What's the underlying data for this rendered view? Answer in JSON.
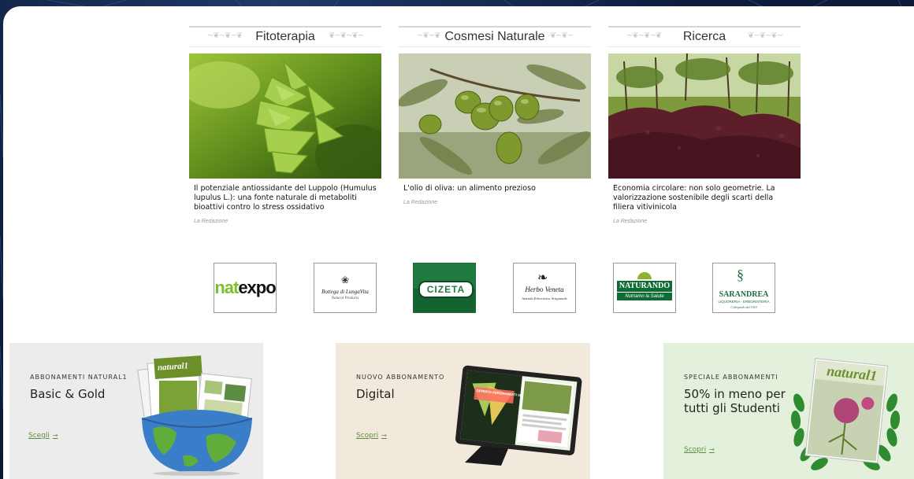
{
  "columns": [
    {
      "title": "Fitoterapia",
      "headline": "Il potenziale antiossidante del Luppolo (Humulus lupulus L.): una fonte naturale di metaboliti bioattivi contro lo stress ossidativo",
      "author": "La Redazione",
      "image": "hop-cone-photo"
    },
    {
      "title": "Cosmesi Naturale",
      "headline": "L'olio di oliva: un alimento prezioso",
      "author": "La Redazione",
      "image": "olives-on-branch-photo"
    },
    {
      "title": "Ricerca",
      "headline": "Economia circolare: non solo geometrie. La valorizzazione sostenibile degli scarti della filiera vitivinicola",
      "author": "La Redazione",
      "image": "vineyard-pomace-photo"
    }
  ],
  "logos": [
    {
      "name": "natexpo",
      "text_a": "nat",
      "text_b": "expo"
    },
    {
      "name": "bottega-lunga-vita",
      "text": "Bottega di LungaVita",
      "sub": "Natural Products"
    },
    {
      "name": "cizeta",
      "text": "CIZETA"
    },
    {
      "name": "herbo-veneta",
      "text": "Herbo Veneta",
      "sub": "Azienda Erboristica Artigianale"
    },
    {
      "name": "naturando",
      "text": "NATURANDO",
      "sub": "Nutriamo la Salute"
    },
    {
      "name": "sarandrea",
      "text": "SARANDREA",
      "sub": "LIQUORERIA - ERBORISTERIA",
      "sub2": "Collepardo dal 1918"
    }
  ],
  "promos": [
    {
      "kicker": "ABBONAMENTI NATURAL1",
      "title": "Basic & Gold",
      "link": "Scegli",
      "bg": "#ececec",
      "magazine_brand": "natural1"
    },
    {
      "kicker": "NUOVO ABBONAMENTO",
      "title": "Digital",
      "link": "Scopri",
      "bg": "#f2e9dd",
      "tablet_text": "OFFERTA ABBONAMENTI SPECIALE STUDENTI"
    },
    {
      "kicker": "SPECIALE ABBONAMENTI",
      "title_line1": "50% in meno per",
      "title_line2": "tutti gli Studenti",
      "link": "Scopri",
      "bg": "#e3f1dc",
      "magazine_brand": "natural1"
    }
  ],
  "accent_link_color": "#5e8d3b"
}
